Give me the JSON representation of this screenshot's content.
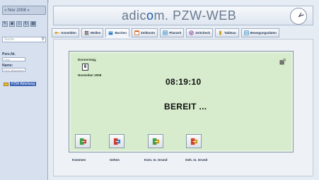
{
  "left_panel": {
    "nav_label": "« Nov 2008 »",
    "toolbar_icons": [
      "pencil-icon",
      "lock-icon",
      "user-icon",
      "refresh-icon",
      "grid-icon"
    ],
    "search_placeholder": "Suche",
    "field1_label": "Pers.Nr.",
    "field1_value": "PZW",
    "field2_label": "Name:",
    "field2_value": "PZW Mitarbeiter",
    "tree_node": "PZW Abteilung"
  },
  "header": {
    "logo_prefix": "adic",
    "logo_accent": "o",
    "logo_suffix": "m.",
    "logo_product": "PZW-WEB"
  },
  "tabs": [
    {
      "label": "Anmelden",
      "icon": "key-icon",
      "color": "#d79a1c"
    },
    {
      "label": "Wollen",
      "icon": "people-icon",
      "color": "#c0392b"
    },
    {
      "label": "Buchen",
      "icon": "book-icon",
      "color": "#2f7fc8",
      "active": true
    },
    {
      "label": "Zeitkonto",
      "icon": "calendar-icon",
      "color": "#d35400"
    },
    {
      "label": "Planzeit",
      "icon": "plan-icon",
      "color": "#2e86c1"
    },
    {
      "label": "Zeitcheck",
      "icon": "check-icon",
      "color": "#7d3c98"
    },
    {
      "label": "Tableau",
      "icon": "phone-icon",
      "color": "#c79a1c"
    },
    {
      "label": "Bewegungsdaten",
      "icon": "list-icon",
      "color": "#2e86c1"
    }
  ],
  "panel": {
    "weekday": "Donnerstag,",
    "day": "6",
    "month_year": "November 2008",
    "time": "08:19:10",
    "status": "BEREIT ..."
  },
  "actions": [
    {
      "label": "Kommen",
      "icon": "kommen-icon"
    },
    {
      "label": "Gehen",
      "icon": "gehen-icon"
    },
    {
      "label": "Kom. m. Grund",
      "icon": "kommen-grund-icon"
    },
    {
      "label": "Geh. m. Grund",
      "icon": "gehen-grund-icon"
    }
  ]
}
